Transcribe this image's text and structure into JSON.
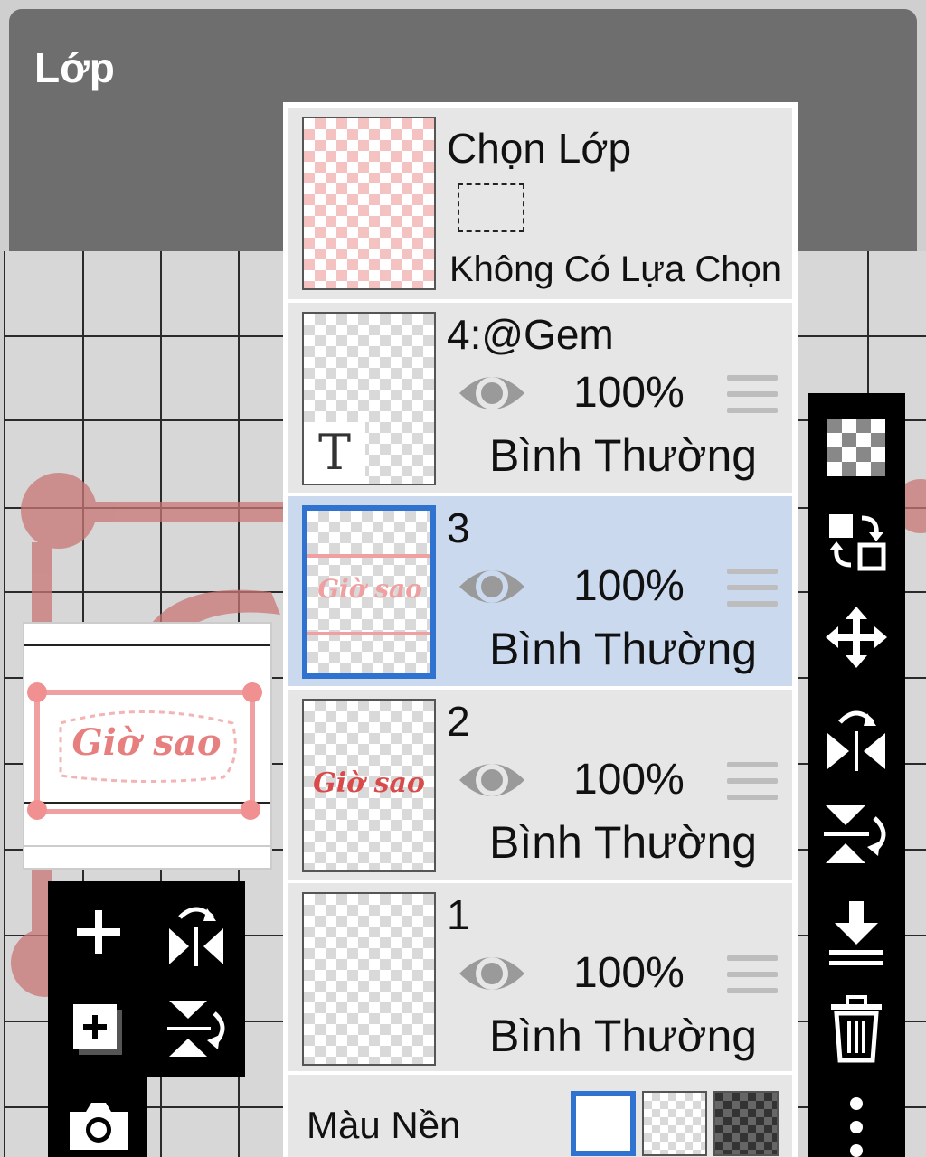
{
  "dialog": {
    "title": "Lớp"
  },
  "selection": {
    "title": "Chọn Lớp",
    "status": "Không Có Lựa Chọn"
  },
  "layers": [
    {
      "name": "4:@Gem",
      "opacity": "100%",
      "blend": "Bình Thường",
      "type": "text",
      "thumb_glyph": "T",
      "selected": false
    },
    {
      "name": "3",
      "opacity": "100%",
      "blend": "Bình Thường",
      "type": "image",
      "thumb_text": "Giờ sao",
      "selected": true
    },
    {
      "name": "2",
      "opacity": "100%",
      "blend": "Bình Thường",
      "type": "image",
      "thumb_text": "Giờ sao",
      "selected": false
    },
    {
      "name": "1",
      "opacity": "100%",
      "blend": "Bình Thường",
      "type": "image",
      "selected": false
    }
  ],
  "background": {
    "label": "Màu Nền",
    "options": [
      "white",
      "transparent",
      "dark-checker"
    ],
    "selected": "white"
  },
  "preview": {
    "text": "Giờ sao"
  },
  "right_toolbar": [
    "transparency-icon",
    "swap-layers-icon",
    "move-icon",
    "flip-horizontal-icon",
    "flip-vertical-icon",
    "merge-down-icon",
    "trash-icon",
    "more-icon"
  ],
  "left_toolbar": [
    "add-layer-icon",
    "flip-horizontal-icon",
    "add-layer-copy-icon",
    "flip-vertical-icon",
    "camera-icon"
  ],
  "colors": {
    "accent": "#2f72d0",
    "panel": "#e6e6e6",
    "selected_row": "#cbd9ee",
    "header": "#6e6e6e",
    "pink": "#e8827f"
  }
}
